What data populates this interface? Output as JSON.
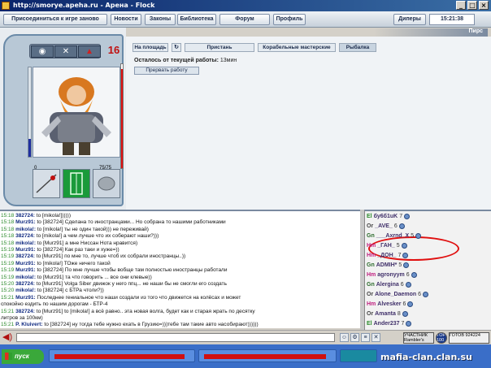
{
  "window": {
    "title": "http://smorye.apeha.ru - Арена - Flock"
  },
  "menu": {
    "items": [
      "Присоединиться к игре заново",
      "Новости",
      "Законы",
      "Библиотека",
      "Форум",
      "Профиль",
      "Диперы"
    ],
    "clock": "15:21:38"
  },
  "location": "Пирс",
  "character": {
    "level": "16",
    "hp_fraction": 0.95,
    "hp_max_label": "75/75",
    "tiny_zero": "0",
    "icons": [
      "eye-icon",
      "tools-icon",
      "figure-icon"
    ]
  },
  "tabs": [
    "На площадь",
    "Пристань",
    "Корабельные мастерские",
    "Рыбалка"
  ],
  "work": {
    "label": "Осталось от текущей работы:",
    "time": "13мин",
    "button": "Прервать работу"
  },
  "chat": [
    {
      "ts": "15:18",
      "nick": "382724:",
      "text": " to [mikola!])))))"
    },
    {
      "ts": "15:18",
      "nick": "Murz91:",
      "text": " to [382724] Сделана то иностранцами... Но собрана то нашими работниками"
    },
    {
      "ts": "15:18",
      "nick": "mikola!:",
      "text": " to [mikola!] ты не один такой))) не переживай)"
    },
    {
      "ts": "15:18",
      "nick": "382724:",
      "text": " to [mikola!] а чем лучше что их соберают наши?)))"
    },
    {
      "ts": "15:18",
      "nick": "mikola!:",
      "text": " to [Murz91] а мне Ниссан Нота нравится)"
    },
    {
      "ts": "15:19",
      "nick": "Murz91:",
      "text": " to [382724] Как раз таки и хуже=))"
    },
    {
      "ts": "15:19",
      "nick": "382724:",
      "text": " to [Murz91] по мне то, лучше чтоб их собрали иностранцы..))"
    },
    {
      "ts": "15:19",
      "nick": "Murz91:",
      "text": " to [mikola!] ТОже ничего такой"
    },
    {
      "ts": "15:19",
      "nick": "Murz91:",
      "text": " to [382724] По мне лучше чтобы вобще там полностью иностранцы работали"
    },
    {
      "ts": "15:19",
      "nick": "mikola!:",
      "text": " to [Murz91] та что говорить ... все они клевые))"
    },
    {
      "ts": "15:20",
      "nick": "382724:",
      "text": " to [Murz91] Volga Siber движок у него ппц... не наши бы не смогли его создать"
    },
    {
      "ts": "15:20",
      "nick": "mikola!:",
      "text": " to [382724] с БТРа чтоли?))"
    },
    {
      "ts": "15:21",
      "nick": "Murz91:",
      "text": " Последнее гениальное что наши создали из того что движется на колёсах и может"
    },
    {
      "ts": "",
      "nick": "",
      "text": "спокойно ездить по нашим дорогам - БТР-4"
    },
    {
      "ts": "15:21",
      "nick": "382724:",
      "text": " to [Murz91] to [mikola!] а всё равно.. эта новая волга, будет как и старая жрать по десятку"
    },
    {
      "ts": "",
      "nick": "",
      "text": "литров за 100км)"
    },
    {
      "ts": "15:21",
      "nick": "P. Kluivert:",
      "text": " to [382724] ну тогда тебе нужно ехать в Грузию=)))тебе там такие авто насобирают))))))"
    }
  ],
  "users": [
    {
      "clan": "El",
      "clan_color": "#2a8a2a",
      "name": "бу6б1uK",
      "level": "7"
    },
    {
      "clan": "Or",
      "clan_color": "#444444",
      "name": "_AVE_",
      "level": "6"
    },
    {
      "clan": "Gn",
      "clan_color": "#2a6a2a",
      "name": "___Axrnd_X",
      "level": "5"
    },
    {
      "clan": "Hm",
      "clan_color": "#c02080",
      "name": "_ГАН_",
      "level": "5"
    },
    {
      "clan": "Hm",
      "clan_color": "#c02080",
      "name": "_ДОН_",
      "level": "7"
    },
    {
      "clan": "Gn",
      "clan_color": "#2a6a2a",
      "name": "ADMIH*",
      "level": "5"
    },
    {
      "clan": "Hm",
      "clan_color": "#c02080",
      "name": "agronyym",
      "level": "6"
    },
    {
      "clan": "Gn",
      "clan_color": "#2a6a2a",
      "name": "Alergina",
      "level": "6"
    },
    {
      "clan": "Or",
      "clan_color": "#444444",
      "name": "Alone_Daemon",
      "level": "6"
    },
    {
      "clan": "Hm",
      "clan_color": "#c02080",
      "name": "Alvesker",
      "level": "6"
    },
    {
      "clan": "Or",
      "clan_color": "#444444",
      "name": "Amanta",
      "level": "8"
    },
    {
      "clan": "El",
      "clan_color": "#2a8a2a",
      "name": "Ander237",
      "level": "7"
    }
  ],
  "badges": {
    "participant": "УЧАСТНИК Rambler's",
    "top100": "TOP 100",
    "counter": "ГОТОВ 924224"
  },
  "taskbar": {
    "start": "пуск"
  },
  "watermark": "mafia-clan.clan.su"
}
